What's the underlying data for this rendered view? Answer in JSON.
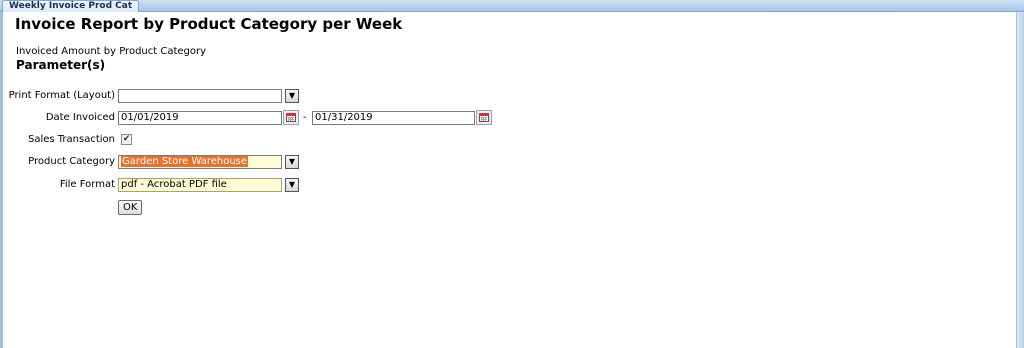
{
  "tab": {
    "label": "Weekly Invoice Prod Cat"
  },
  "header": {
    "title": "Invoice Report by Product Category per Week",
    "subtitle": "Invoiced Amount by Product Category",
    "section": "Parameter(s)"
  },
  "form": {
    "print_format": {
      "label": "Print Format (Layout)",
      "value": ""
    },
    "date_invoiced": {
      "label": "Date Invoiced",
      "from": "01/01/2019",
      "separator": "-",
      "to": "01/31/2019"
    },
    "sales_transaction": {
      "label": "Sales Transaction",
      "checked": true,
      "check_glyph": "✔"
    },
    "product_category": {
      "label": "Product Category",
      "value": "Garden Store Warehouse"
    },
    "file_format": {
      "label": "File Format",
      "value": "pdf - Acrobat PDF file"
    },
    "dropdown_glyph": "▼",
    "ok_label": "OK"
  },
  "colors": {
    "highlight": "#e5722e",
    "field_yellow": "#fffbd6",
    "tab_blue": "#a9c6e6"
  }
}
